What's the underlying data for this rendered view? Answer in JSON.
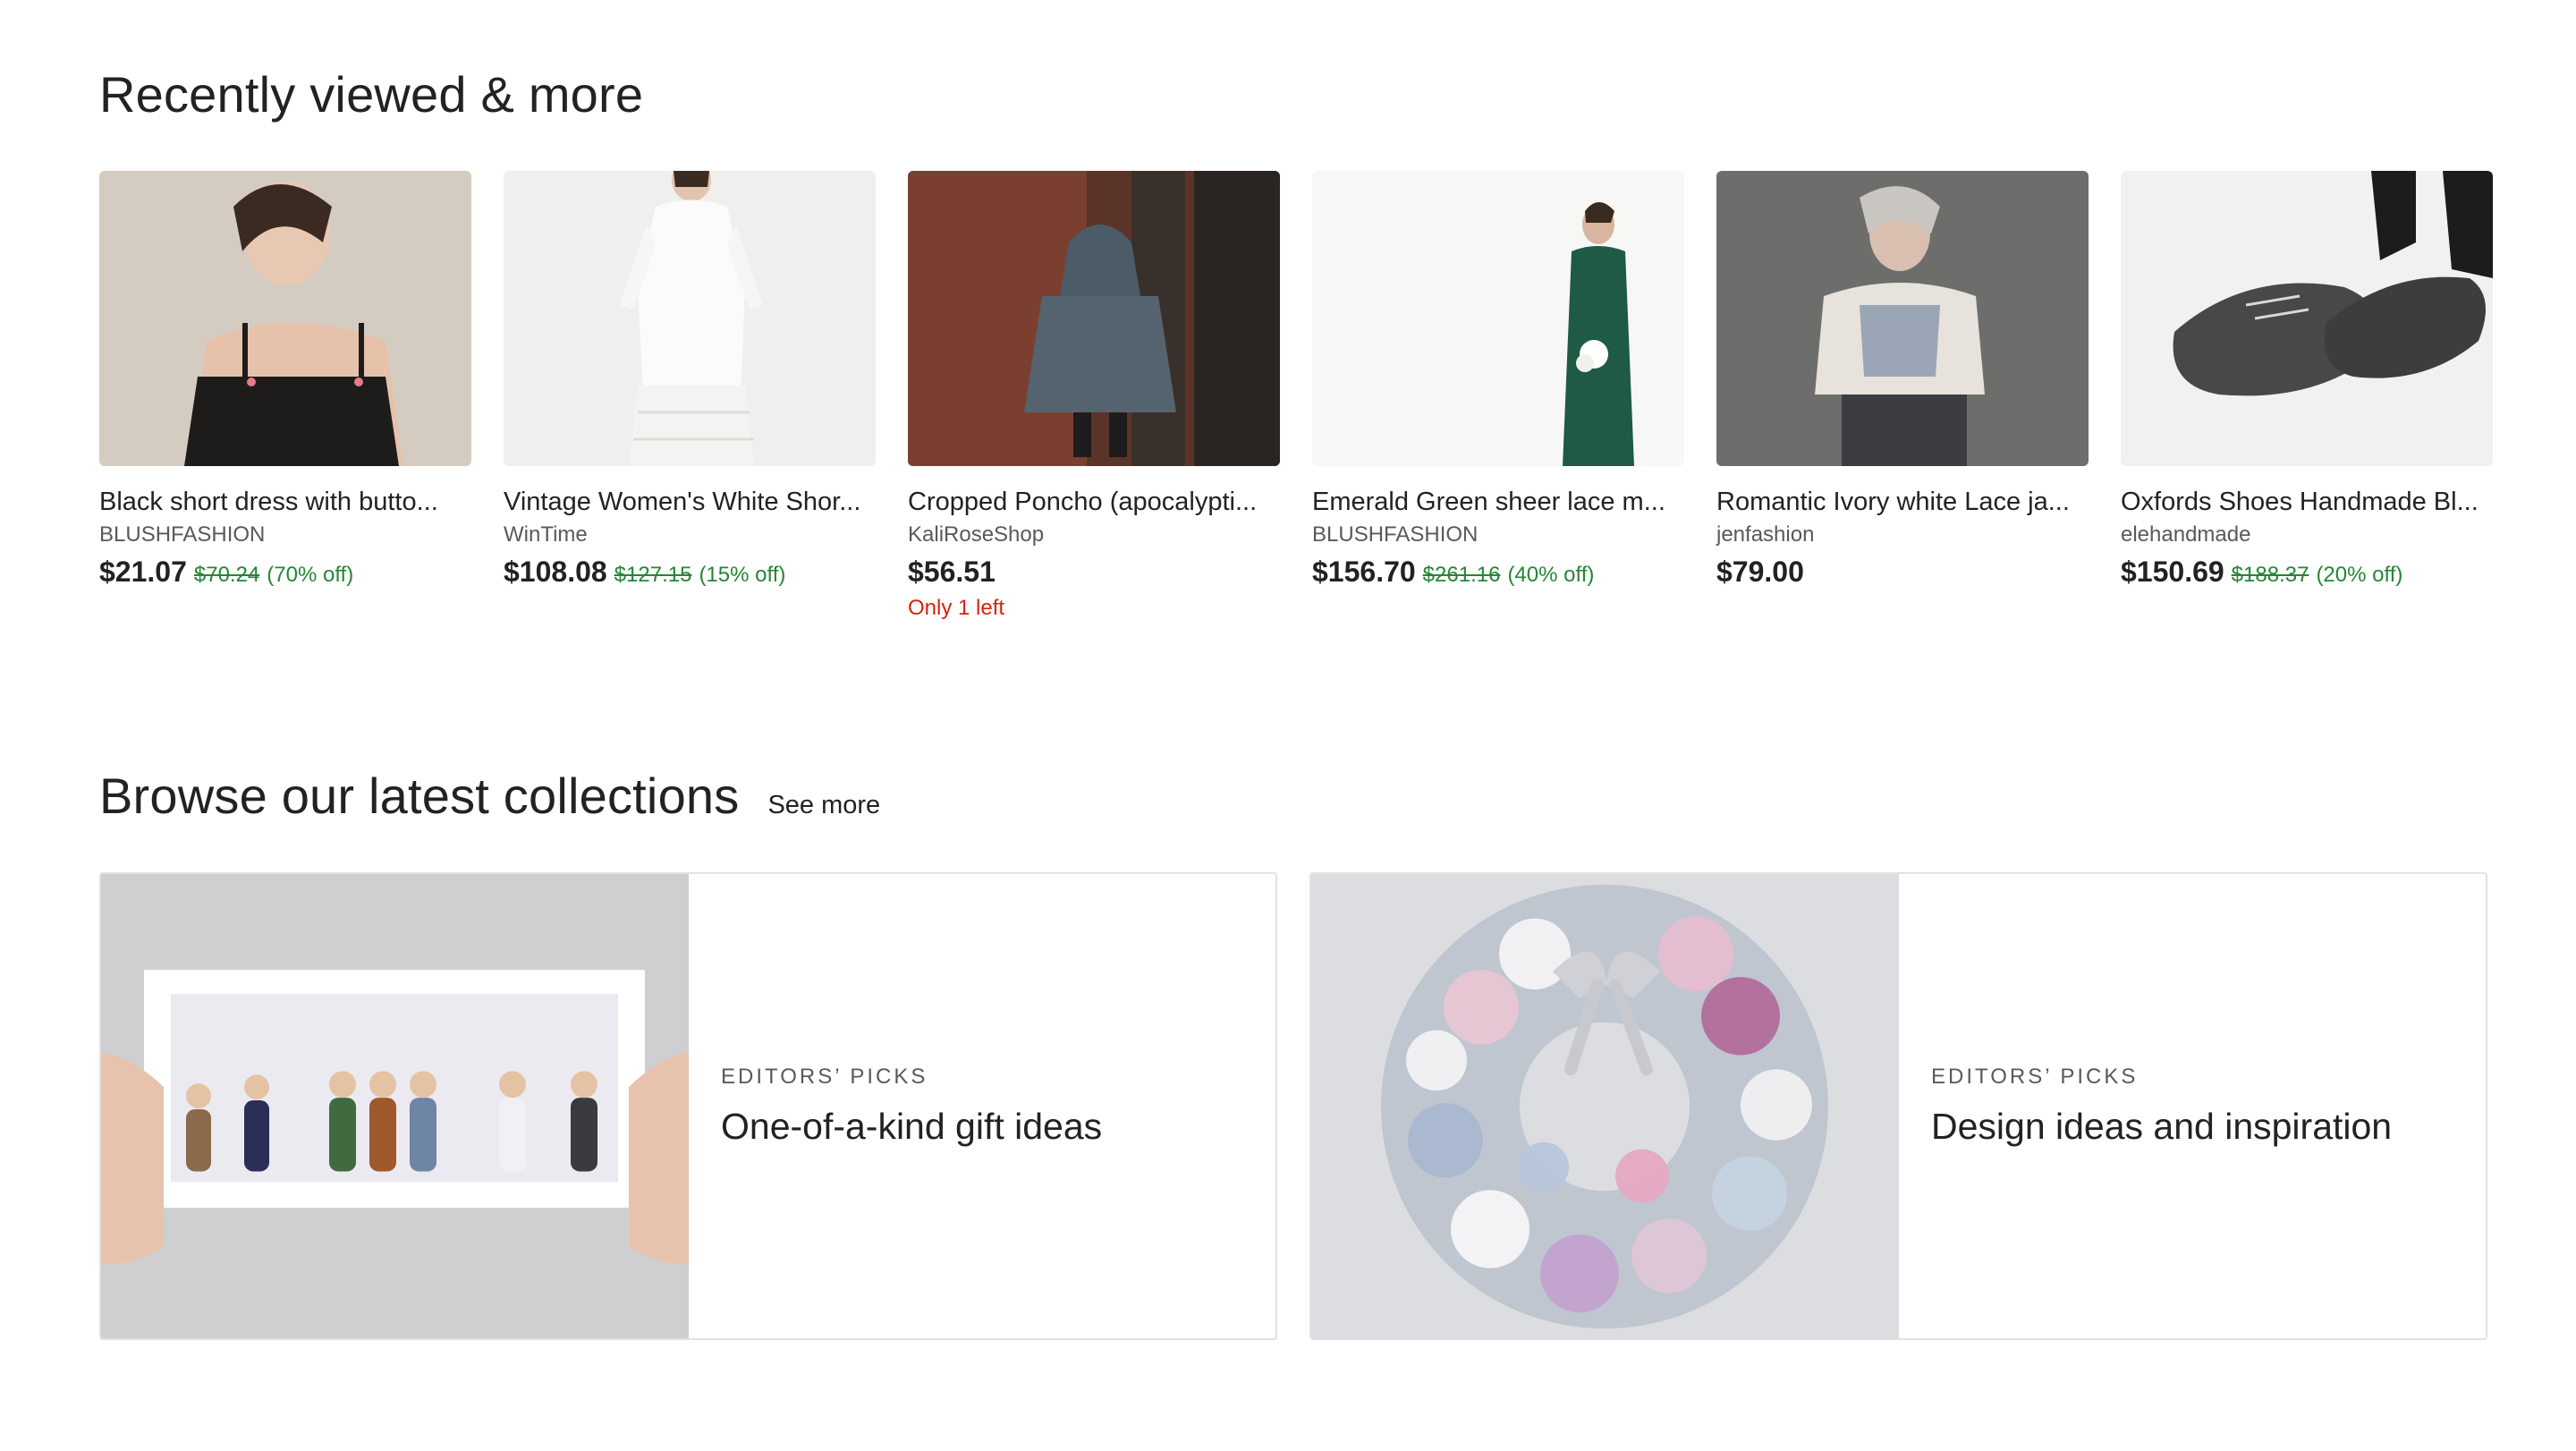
{
  "recent": {
    "title": "Recently viewed & more",
    "items": [
      {
        "title": "Black short dress with butto...",
        "shop": "BLUSHFASHION",
        "price": "$21.07",
        "original": "$70.24",
        "discount": "(70% off)",
        "note": ""
      },
      {
        "title": "Vintage Women's White Shor...",
        "shop": "WinTime",
        "price": "$108.08",
        "original": "$127.15",
        "discount": "(15% off)",
        "note": ""
      },
      {
        "title": "Cropped Poncho (apocalypti...",
        "shop": "KaliRoseShop",
        "price": "$56.51",
        "original": "",
        "discount": "",
        "note": "Only 1 left"
      },
      {
        "title": "Emerald Green sheer lace m...",
        "shop": "BLUSHFASHION",
        "price": "$156.70",
        "original": "$261.16",
        "discount": "(40% off)",
        "note": ""
      },
      {
        "title": "Romantic Ivory white Lace ja...",
        "shop": "jenfashion",
        "price": "$79.00",
        "original": "",
        "discount": "",
        "note": ""
      },
      {
        "title": "Oxfords Shoes Handmade Bl...",
        "shop": "elehandmade",
        "price": "$150.69",
        "original": "$188.37",
        "discount": "(20% off)",
        "note": ""
      }
    ]
  },
  "collections": {
    "title": "Browse our latest collections",
    "see_more": "See more",
    "cards": [
      {
        "eyebrow": "Editors’ Picks",
        "title": "One-of-a-kind gift ideas"
      },
      {
        "eyebrow": "Editors’ Picks",
        "title": "Design ideas and inspiration"
      }
    ]
  },
  "colors": {
    "sale_green": "#258635",
    "stock_red": "#d5230e",
    "text": "#222222",
    "muted": "#595959",
    "border": "#e1e3df"
  }
}
